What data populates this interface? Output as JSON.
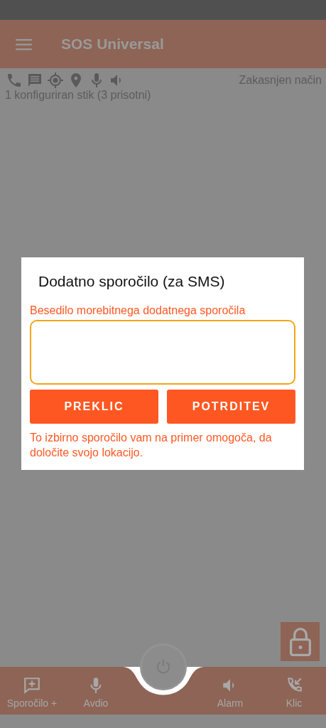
{
  "app_bar": {
    "title": "SOS Universal"
  },
  "status": {
    "sticks": "1 konfiguriran stik (3 prisotni)",
    "mode": "Zakasnjen način"
  },
  "dialog": {
    "title": "Dodatno sporočilo (za SMS)",
    "field_label": "Besedilo morebitnega dodatnega sporočila",
    "buttons": [
      "PREKLIC",
      "POTRDITEV"
    ],
    "note": "To izbirno sporočilo vam na primer omogoča, da določite svojo lokacijo."
  },
  "bottom_nav": [
    {
      "label": "Sporočilo +"
    },
    {
      "label": "Avdio"
    },
    {
      "label": "Alarm"
    },
    {
      "label": "Klic"
    }
  ]
}
